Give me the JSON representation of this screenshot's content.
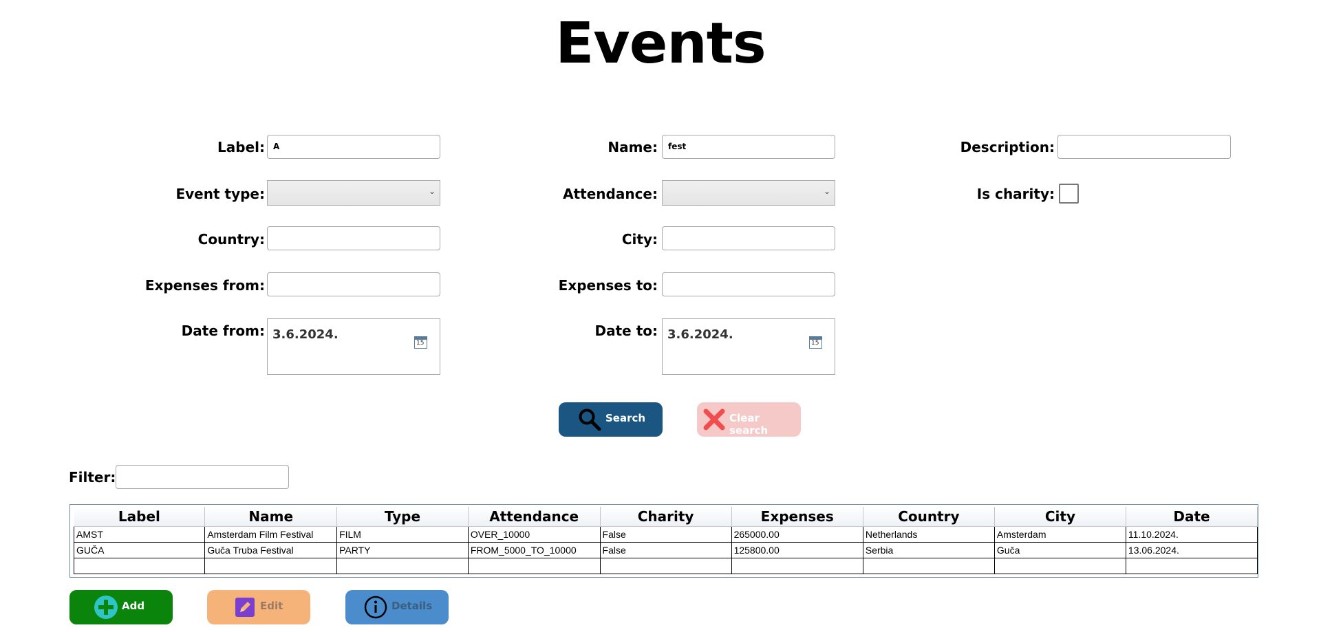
{
  "page": {
    "title": "Events"
  },
  "form": {
    "label": {
      "label": "Label:",
      "value": "A"
    },
    "name": {
      "label": "Name:",
      "value": "fest"
    },
    "description": {
      "label": "Description:",
      "value": ""
    },
    "event_type": {
      "label": "Event type:",
      "value": ""
    },
    "attendance": {
      "label": "Attendance:",
      "value": ""
    },
    "is_charity": {
      "label": "Is charity:",
      "checked": false
    },
    "country": {
      "label": "Country:",
      "value": ""
    },
    "city": {
      "label": "City:",
      "value": ""
    },
    "expenses_from": {
      "label": "Expenses from:",
      "value": ""
    },
    "expenses_to": {
      "label": "Expenses to:",
      "value": ""
    },
    "date_from": {
      "label": "Date from:",
      "value": "3.6.2024.",
      "icon_text": "15"
    },
    "date_to": {
      "label": "Date to:",
      "value": "3.6.2024.",
      "icon_text": "15"
    }
  },
  "actions": {
    "search": {
      "label": "Search",
      "icon": "search-icon",
      "color": "#1b5582"
    },
    "clear": {
      "label": "Clear search",
      "icon": "close-icon",
      "color": "#f6c9c9"
    }
  },
  "filter": {
    "label": "Filter:",
    "value": ""
  },
  "table": {
    "columns": [
      "Label",
      "Name",
      "Type",
      "Attendance",
      "Charity",
      "Expenses",
      "Country",
      "City",
      "Date"
    ],
    "rows": [
      [
        "AMST",
        "Amsterdam Film Festival",
        "FILM",
        "OVER_10000",
        "False",
        "265000.00",
        "Netherlands",
        "Amsterdam",
        "11.10.2024."
      ],
      [
        "GUČA",
        "Guča Truba Festival",
        "PARTY",
        "FROM_5000_TO_10000",
        "False",
        "125800.00",
        "Serbia",
        "Guča",
        "13.06.2024."
      ],
      [
        "",
        "",
        "",
        "",
        "",
        "",
        "",
        "",
        ""
      ]
    ]
  },
  "bottom_buttons": {
    "add": {
      "label": "Add",
      "icon": "plus-circle-icon",
      "color": "#0a840a"
    },
    "edit": {
      "label": "Edit",
      "icon": "pencil-icon",
      "color": "#f5b37a"
    },
    "details": {
      "label": "Details",
      "icon": "info-icon",
      "color": "#4a8ccc"
    }
  }
}
